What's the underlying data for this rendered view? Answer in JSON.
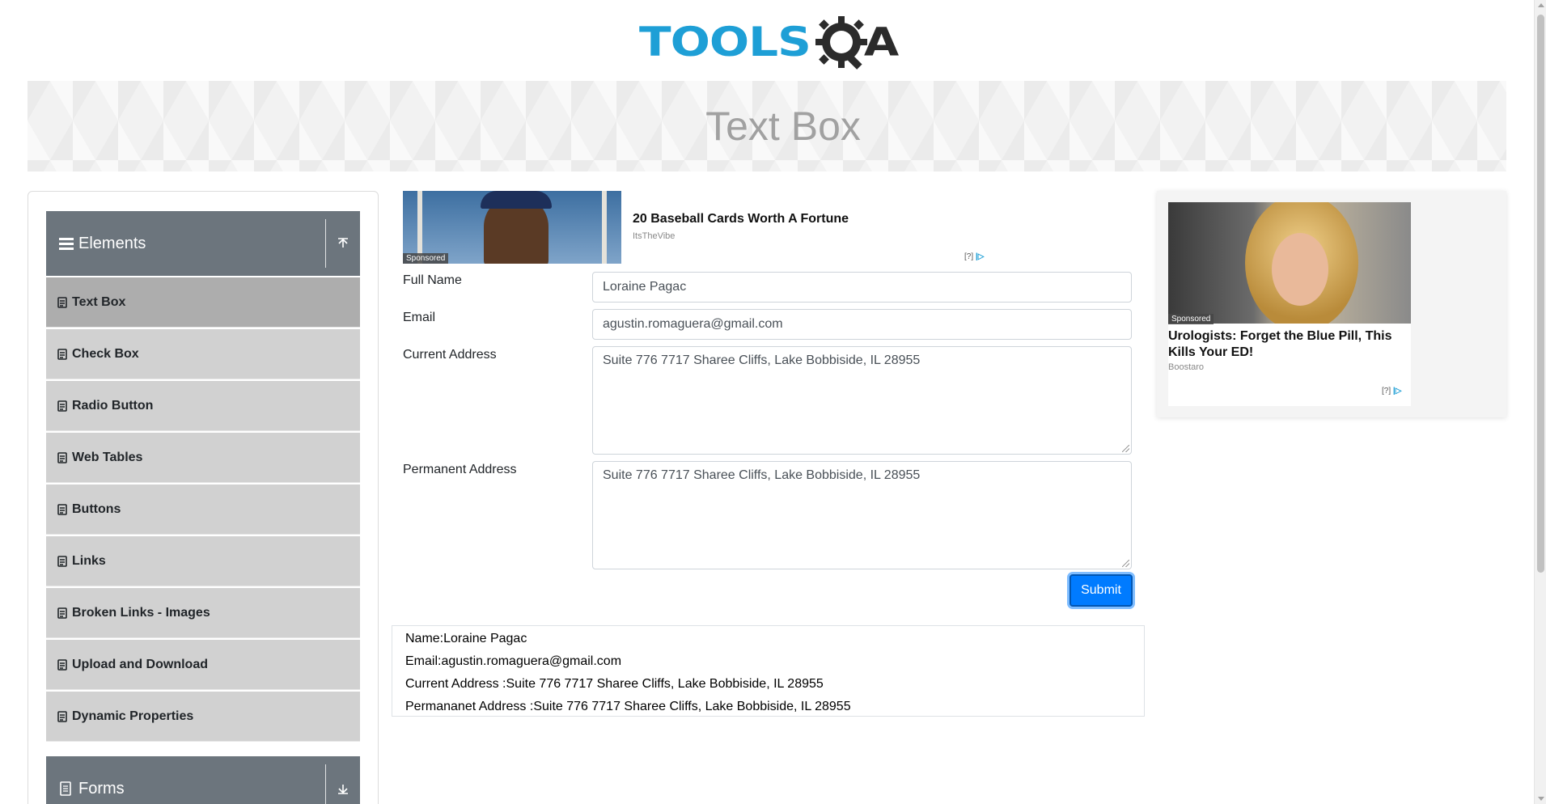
{
  "header": {
    "logo_text_left": "TOOLS",
    "logo_text_right": "A",
    "logo_colors": {
      "tools": "#1e9fd6",
      "gear": "#2b2b2b"
    }
  },
  "banner": {
    "title": "Text Box"
  },
  "sidebar": {
    "group": {
      "title": "Elements",
      "icon": "hamburger-icon",
      "toggle_icon": "collapse-up-icon"
    },
    "items": [
      {
        "label": "Text Box",
        "active": true
      },
      {
        "label": "Check Box"
      },
      {
        "label": "Radio Button"
      },
      {
        "label": "Web Tables"
      },
      {
        "label": "Buttons"
      },
      {
        "label": "Links"
      },
      {
        "label": "Broken Links - Images"
      },
      {
        "label": "Upload and Download"
      },
      {
        "label": "Dynamic Properties"
      }
    ],
    "next_group": {
      "title": "Forms",
      "icon": "document-icon",
      "toggle_icon": "expand-down-icon"
    }
  },
  "ad_top": {
    "title": "20 Baseball Cards Worth A Fortune",
    "source": "ItsTheVibe",
    "sponsored": "Sponsored",
    "choice": "[?]"
  },
  "form": {
    "full_name_label": "Full Name",
    "full_name_value": "Loraine Pagac",
    "email_label": "Email",
    "email_value": "agustin.romaguera@gmail.com",
    "current_address_label": "Current Address",
    "current_address_value": "Suite 776 7717 Sharee Cliffs, Lake Bobbiside, IL 28955",
    "permanent_address_label": "Permanent Address",
    "permanent_address_value": "Suite 776 7717 Sharee Cliffs, Lake Bobbiside, IL 28955",
    "submit_label": "Submit",
    "submit_color": "#007bff"
  },
  "output": {
    "name": "Name:Loraine Pagac",
    "email": "Email:agustin.romaguera@gmail.com",
    "current_address": "Current Address :Suite 776 7717 Sharee Cliffs, Lake Bobbiside, IL 28955",
    "permanent_address": "Permananet Address :Suite 776 7717 Sharee Cliffs, Lake Bobbiside, IL 28955"
  },
  "ad_right": {
    "title": "Urologists: Forget the Blue Pill, This Kills Your ED!",
    "source": "Boostaro",
    "sponsored": "Sponsored",
    "choice": "[?]"
  }
}
